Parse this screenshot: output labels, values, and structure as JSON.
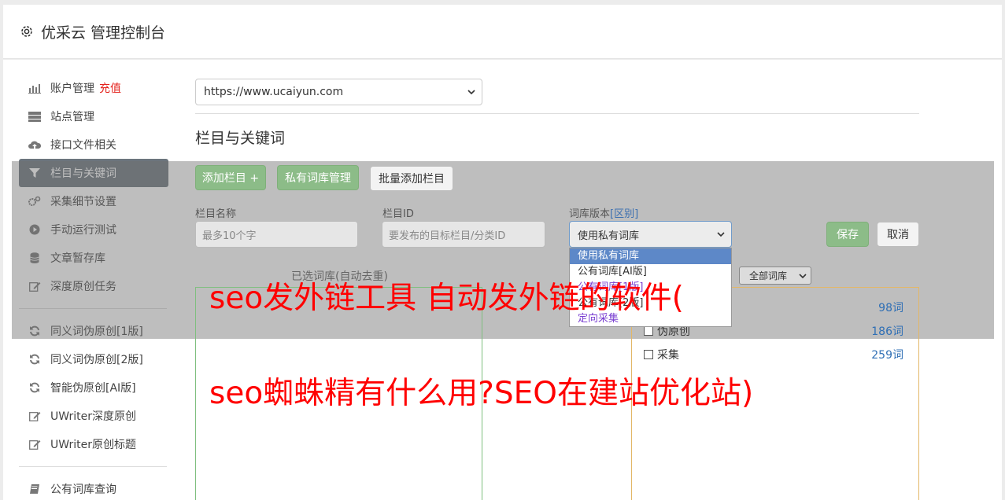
{
  "header": {
    "title": "优采云 管理控制台"
  },
  "sidebar": {
    "items": [
      {
        "label": "账户管理",
        "badge": "充值",
        "icon": "bar-chart-icon"
      },
      {
        "label": "站点管理",
        "icon": "server-icon"
      },
      {
        "label": "接口文件相关",
        "icon": "cloud-upload-icon"
      },
      {
        "label": "栏目与关键词",
        "icon": "filter-icon",
        "active": true
      },
      {
        "label": "采集细节设置",
        "icon": "cogs-icon"
      },
      {
        "label": "手动运行测试",
        "icon": "play-circle-icon"
      },
      {
        "label": "文章暂存库",
        "icon": "database-icon"
      },
      {
        "label": "深度原创任务",
        "icon": "edit-icon"
      },
      {
        "label": "同义词伪原创[1版]",
        "icon": "refresh-icon"
      },
      {
        "label": "同义词伪原创[2版]",
        "icon": "refresh-icon"
      },
      {
        "label": "智能伪原创[AI版]",
        "icon": "refresh-icon"
      },
      {
        "label": "UWriter深度原创",
        "icon": "edit-icon"
      },
      {
        "label": "UWriter原创标题",
        "icon": "edit-icon"
      },
      {
        "label": "公有词库查询",
        "icon": "book-icon"
      }
    ]
  },
  "main": {
    "site_select_value": "https://www.ucaiyun.com",
    "section_title": "栏目与关键词",
    "buttons": {
      "add_column": "添加栏目 +",
      "private_lib": "私有词库管理",
      "batch_add": "批量添加栏目",
      "save": "保存",
      "cancel": "取消"
    },
    "form": {
      "name_label": "栏目名称",
      "name_placeholder": "最多10个字",
      "id_label": "栏目ID",
      "id_placeholder": "要发布的目标栏目/分类ID",
      "version_label": "词库版本",
      "version_link": "[区别]",
      "version_value": "使用私有词库"
    },
    "dropdown_options": [
      "使用私有词库",
      "公有词库[AI版]",
      "公有词库[1版]",
      "公有词库[2版]",
      "定向采集"
    ],
    "selected_libs_label": "已选词库(自动去重)",
    "category_select_value": "全部词库",
    "libs": [
      {
        "label": "",
        "count": "98词"
      },
      {
        "label": "伪原创",
        "count": "186词"
      },
      {
        "label": "采集",
        "count": "259词"
      }
    ]
  },
  "watermark": {
    "line1": "seo发外链工具 自动发外链的软件(",
    "line2": "seo蜘蛛精有什么用?SEO在建站优化站)"
  },
  "colors": {
    "active_nav": "#6c757d",
    "green_button": "#5cb85c",
    "watermark": "#ff0000",
    "badge": "#e4221c"
  }
}
